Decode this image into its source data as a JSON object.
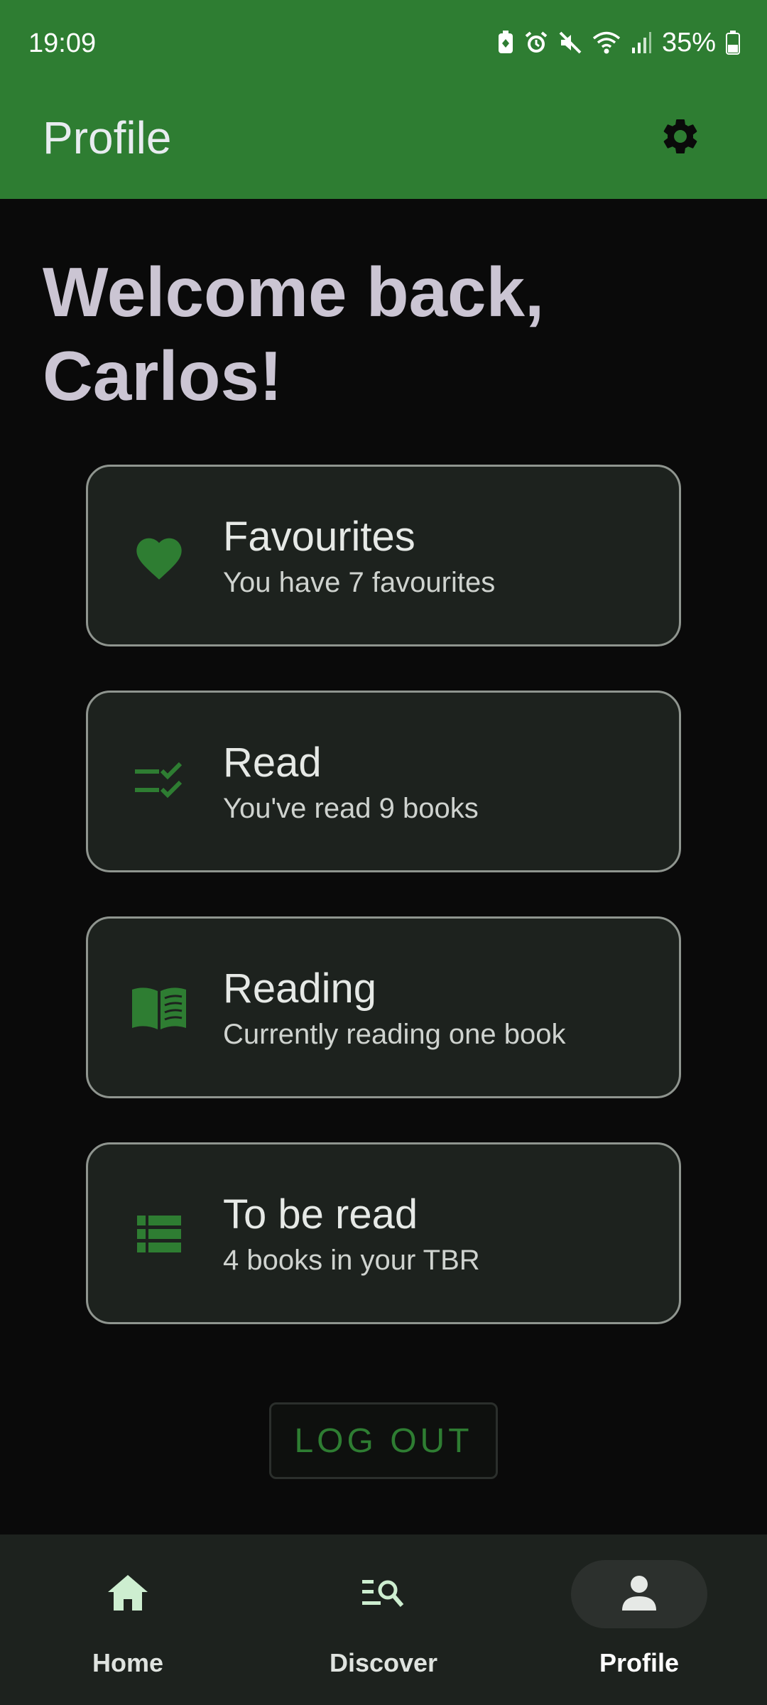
{
  "status_bar": {
    "time": "19:09",
    "battery": "35%",
    "icons": [
      "battery-saver-icon",
      "alarm-icon",
      "mute-icon",
      "wifi-icon",
      "signal-icon",
      "battery-icon"
    ]
  },
  "app_bar": {
    "title": "Profile",
    "settings_icon": "gear-icon"
  },
  "welcome": {
    "line1": "Welcome back,",
    "line2": "Carlos!"
  },
  "cards": [
    {
      "icon": "heart-icon",
      "title": "Favourites",
      "subtitle": "You have 7 favourites"
    },
    {
      "icon": "checklist-icon",
      "title": "Read",
      "subtitle": "You've read 9 books"
    },
    {
      "icon": "book-open-icon",
      "title": "Reading",
      "subtitle": "Currently reading one book"
    },
    {
      "icon": "list-icon",
      "title": "To be read",
      "subtitle": "4 books in your TBR"
    }
  ],
  "logout_label": "LOG OUT",
  "bottom_nav": {
    "items": [
      {
        "icon": "home-icon",
        "label": "Home",
        "active": false
      },
      {
        "icon": "search-list-icon",
        "label": "Discover",
        "active": false
      },
      {
        "icon": "person-icon",
        "label": "Profile",
        "active": true
      }
    ]
  },
  "colors": {
    "accent": "#2e7d32",
    "background": "#0a0a0a",
    "card": "#1d221e",
    "welcome_text": "#cbc5d3"
  }
}
